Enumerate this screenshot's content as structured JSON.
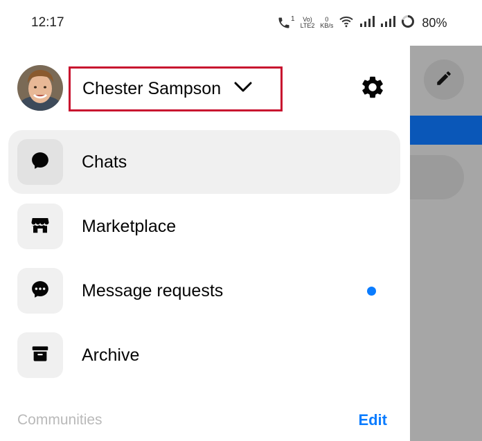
{
  "status_bar": {
    "time": "12:17",
    "call_badge": "1",
    "volte_top": "Vo)",
    "volte_bottom": "LTE2",
    "speed_value": "0",
    "speed_unit": "KB/s",
    "battery": "80%"
  },
  "account": {
    "name": "Chester Sampson"
  },
  "menu": {
    "items": [
      {
        "label": "Chats",
        "icon": "chat-bubble-icon",
        "active": true
      },
      {
        "label": "Marketplace",
        "icon": "storefront-icon",
        "active": false
      },
      {
        "label": "Message requests",
        "icon": "message-dots-icon",
        "active": false,
        "unread": true
      },
      {
        "label": "Archive",
        "icon": "archive-box-icon",
        "active": false
      }
    ]
  },
  "communities": {
    "label": "Communities",
    "edit_label": "Edit"
  },
  "colors": {
    "accent": "#0a7cff",
    "highlight_border": "#c8102e",
    "active_row": "#f0f0f0",
    "overlay": "#a6a6a6",
    "overlay_blue": "#0a57b8"
  }
}
